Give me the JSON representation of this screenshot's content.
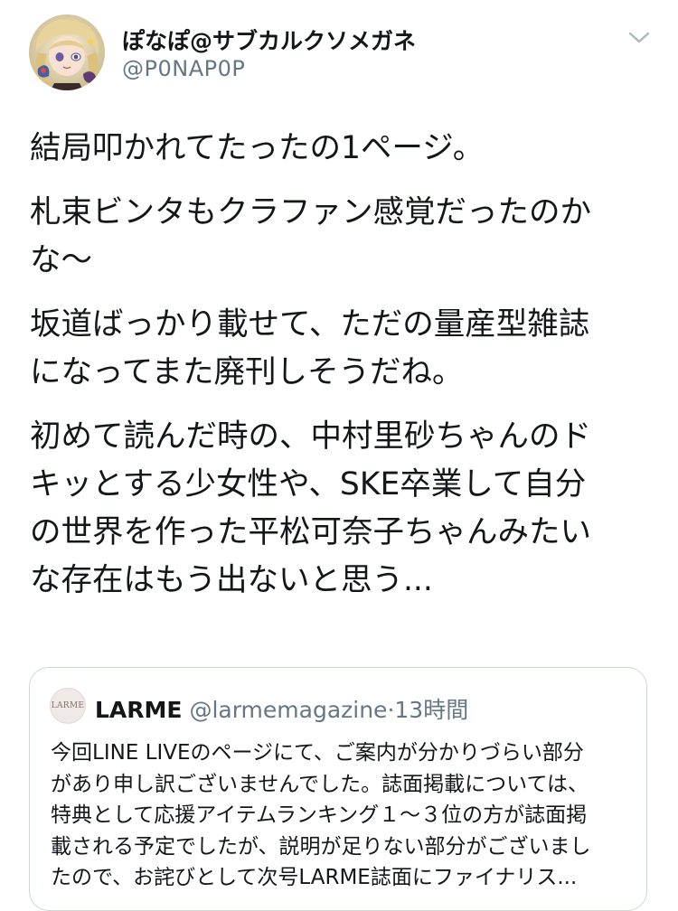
{
  "tweet": {
    "display_name": "ぽなぽ@サブカルクソメガネ",
    "handle": "@P0NAP0P",
    "paragraphs": [
      "結局叩かれてたったの1ページ。",
      "札束ビンタもクラファン感覚だったのか\nな〜",
      "坂道ばっかり載せて、ただの量産型雑誌\nになってまた廃刊しそうだね。",
      "初めて読んだ時の、中村里砂ちゃんのド\nキッとする少女性や、SKE卒業して自分\nの世界を作った平松可奈子ちゃんみたい\nな存在はもう出ないと思う..."
    ]
  },
  "quoted_tweet": {
    "avatar_text": "LARME",
    "name": "LARME",
    "handle": "@larmemagazine",
    "separator": "·",
    "time": "13時間",
    "text": "今回LINE LIVEのページにて、ご案内が分かりづらい部分\nがあり申し訳ございませんでした。誌面掲載については、\n特典として応援アイテムランキング１〜３位の方が誌面掲\n載される予定でしたが、説明が足りない部分がございまし\nたので、お詫びとして次号LARME誌面にファイナリス..."
  },
  "icons": {
    "more": "chevron-down-icon",
    "avatar": "user-avatar-illustration"
  },
  "colors": {
    "text_primary": "#14171a",
    "text_secondary": "#657786",
    "border": "#ccd6dd"
  }
}
